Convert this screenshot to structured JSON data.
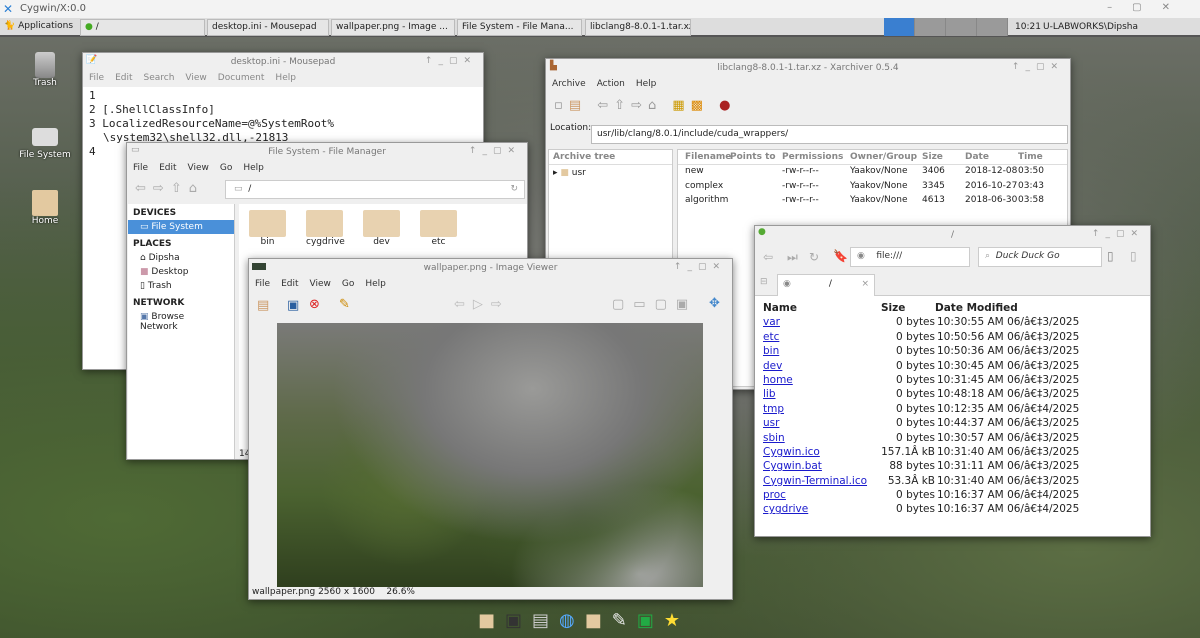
{
  "outer": {
    "title": "Cygwin/X:0.0"
  },
  "taskbar": {
    "apps": "Applications",
    "tasks": [
      "/",
      "desktop.ini - Mousepad",
      "wallpaper.png - Image ...",
      "File System - File Mana...",
      "libclang8-8.0.1-1.tar.xz ..."
    ],
    "clock": "10:21",
    "user": "U-LABWORKS\\Dipsha"
  },
  "desktop_icons": [
    "Trash",
    "File System",
    "Home"
  ],
  "mousepad": {
    "title": "desktop.ini - Mousepad",
    "menu": [
      "File",
      "Edit",
      "Search",
      "View",
      "Document",
      "Help"
    ],
    "lines": [
      {
        "n": "1",
        "t": ""
      },
      {
        "n": "2",
        "t": "[.ShellClassInfo]"
      },
      {
        "n": "3",
        "t": "LocalizedResourceName=@%SystemRoot%"
      },
      {
        "n": "",
        "t": "\\system32\\shell32.dll,-21813"
      },
      {
        "n": "4",
        "t": ""
      }
    ]
  },
  "xarchiver": {
    "title": "libclang8-8.0.1-1.tar.xz - Xarchiver 0.5.4",
    "menu": [
      "Archive",
      "Action",
      "Help"
    ],
    "location_label": "Location:",
    "location": "usr/lib/clang/8.0.1/include/cuda_wrappers/",
    "tree_header": "Archive tree",
    "tree": [
      "usr"
    ],
    "columns": [
      "Filename",
      "Points to",
      "Permissions",
      "Owner/Group",
      "Size",
      "Date",
      "Time"
    ],
    "rows": [
      [
        "new",
        "",
        "-rw-r--r--",
        "Yaakov/None",
        "3406",
        "2018-12-08",
        "03:50"
      ],
      [
        "complex",
        "",
        "-rw-r--r--",
        "Yaakov/None",
        "3345",
        "2016-10-27",
        "03:43"
      ],
      [
        "algorithm",
        "",
        "-rw-r--r--",
        "Yaakov/None",
        "4613",
        "2018-06-30",
        "03:58"
      ]
    ]
  },
  "filemanager": {
    "title": "File System - File Manager",
    "menu": [
      "File",
      "Edit",
      "View",
      "Go",
      "Help"
    ],
    "path": "/",
    "devices_header": "DEVICES",
    "devices": [
      "File System"
    ],
    "places_header": "PLACES",
    "places": [
      "Dipsha",
      "Desktop",
      "Trash"
    ],
    "network_header": "NETWORK",
    "network": [
      "Browse Network"
    ],
    "folders": [
      "bin",
      "cygdrive",
      "dev",
      "etc"
    ],
    "status": "14"
  },
  "imageviewer": {
    "title": "wallpaper.png - Image Viewer",
    "menu": [
      "File",
      "Edit",
      "View",
      "Go",
      "Help"
    ],
    "status": "wallpaper.png 2560 x 1600",
    "zoom": "26.6%"
  },
  "browser": {
    "title": "/",
    "url": "file:///",
    "search": "Duck Duck Go",
    "tab": "/",
    "columns": [
      "Name",
      "Size",
      "Date Modified"
    ],
    "rows": [
      [
        "var",
        "0 bytes",
        "10:30:55 AM 06/â€‡3/2025"
      ],
      [
        "etc",
        "0 bytes",
        "10:50:56 AM 06/â€‡3/2025"
      ],
      [
        "bin",
        "0 bytes",
        "10:50:36 AM 06/â€‡3/2025"
      ],
      [
        "dev",
        "0 bytes",
        "10:30:45 AM 06/â€‡3/2025"
      ],
      [
        "home",
        "0 bytes",
        "10:31:45 AM 06/â€‡3/2025"
      ],
      [
        "lib",
        "0 bytes",
        "10:48:18 AM 06/â€‡3/2025"
      ],
      [
        "tmp",
        "0 bytes",
        "10:12:35 AM 06/â€‡4/2025"
      ],
      [
        "usr",
        "0 bytes",
        "10:44:37 AM 06/â€‡3/2025"
      ],
      [
        "sbin",
        "0 bytes",
        "10:30:57 AM 06/â€‡3/2025"
      ],
      [
        "Cygwin.ico",
        "157.1Â kB",
        "10:31:40 AM 06/â€‡3/2025"
      ],
      [
        "Cygwin.bat",
        "88 bytes",
        "10:31:11 AM 06/â€‡3/2025"
      ],
      [
        "Cygwin-Terminal.ico",
        "53.3Â kB",
        "10:31:40 AM 06/â€‡3/2025"
      ],
      [
        "proc",
        "0 bytes",
        "10:16:37 AM 06/â€‡4/2025"
      ],
      [
        "cygdrive",
        "0 bytes",
        "10:16:37 AM 06/â€‡4/2025"
      ]
    ]
  }
}
